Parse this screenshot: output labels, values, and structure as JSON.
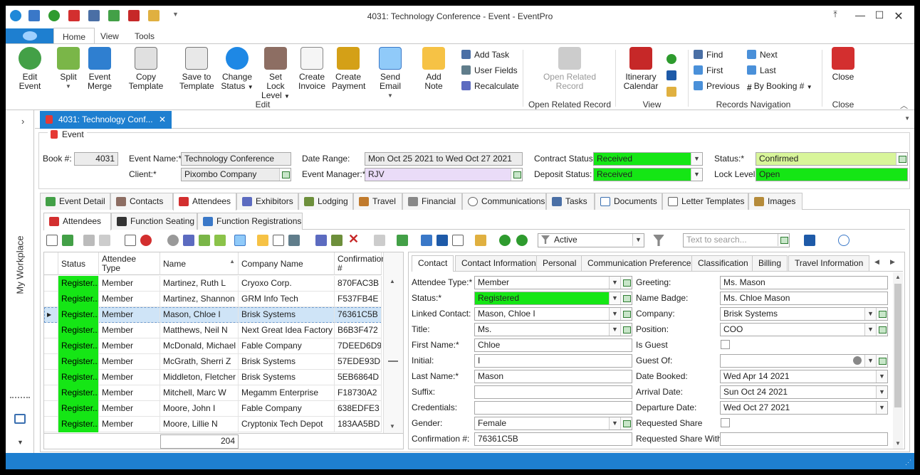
{
  "window": {
    "title": "4031: Technology Conference - Event - EventPro"
  },
  "ribbon_tabs": [
    "Home",
    "View",
    "Tools"
  ],
  "ribbon": {
    "edit_group": {
      "label": "Edit",
      "buttons": [
        "Edit Event",
        "Split",
        "Event Merge",
        "Copy Template",
        "Save to Template",
        "Change Status",
        "Set Lock Level",
        "Create Invoice",
        "Create Payment",
        "Send Email",
        "Add Note"
      ],
      "split_l1": "Split",
      "event_merge_l1": "Event",
      "event_merge_l2": "Merge",
      "save_l1": "Save to",
      "save_l2": "Template",
      "change_l1": "Change",
      "change_l2": "Status",
      "lock_l1": "Set Lock",
      "lock_l2": "Level",
      "inv_l1": "Create",
      "inv_l2": "Invoice",
      "pay_l1": "Create",
      "pay_l2": "Payment",
      "small": [
        "Add Task",
        "User Fields",
        "Recalculate"
      ]
    },
    "open_related": {
      "label": "Open Related Record",
      "l1": "Open Related",
      "l2": "Record"
    },
    "view_group": {
      "label": "View",
      "l1": "Itinerary",
      "l2": "Calendar"
    },
    "nav_group": {
      "label": "Records Navigation",
      "items": [
        "Find",
        "First",
        "Previous",
        "Next",
        "Last",
        "By Booking #"
      ]
    },
    "close_group": {
      "label": "Close",
      "button": "Close"
    }
  },
  "sidebar": {
    "label": "My Workplace"
  },
  "doc_tab": {
    "label": "4031: Technology Conf..."
  },
  "event": {
    "legend": "Event",
    "book_label": "Book #:",
    "book_value": "4031",
    "event_name_label": "Event Name:*",
    "event_name": "Technology Conference",
    "client_label": "Client:*",
    "client": "Pixombo Company",
    "date_range_label": "Date Range:",
    "date_range": "Mon Oct 25 2021 to Wed Oct 27 2021",
    "event_manager_label": "Event Manager:*",
    "event_manager": "RJV",
    "contract_status_label": "Contract Status:",
    "contract_status": "Received",
    "deposit_status_label": "Deposit Status:",
    "deposit_status": "Received",
    "status_label": "Status:*",
    "status": "Confirmed",
    "lock_level_label": "Lock Level:",
    "lock_level": "Open"
  },
  "main_tabs": [
    "Event Detail",
    "Contacts",
    "Attendees",
    "Exhibitors",
    "Lodging",
    "Travel",
    "Financial",
    "Communications",
    "Tasks",
    "Documents",
    "Letter Templates",
    "Images"
  ],
  "sub_tabs": [
    "Attendees",
    "Function Seating",
    "Function Registrations"
  ],
  "toolbar": {
    "filter_value": "Active",
    "search_placeholder": "Text to search..."
  },
  "grid": {
    "headers": [
      "Status",
      "Attendee Type",
      "Name",
      "Company Name",
      "Confirmation #"
    ],
    "rows": [
      [
        "Register...",
        "Member",
        "Martinez, Ruth L",
        "Cryoxo Corp.",
        "870FAC3B"
      ],
      [
        "Register...",
        "Member",
        "Martinez, Shannon M",
        "GRM Info Tech",
        "F537FB4E"
      ],
      [
        "Register...",
        "Member",
        "Mason, Chloe I",
        "Brisk Systems",
        "76361C5B"
      ],
      [
        "Register...",
        "Member",
        "Matthews, Neil N",
        "Next Great Idea Factory",
        "B6B3F472"
      ],
      [
        "Register...",
        "Member",
        "McDonald, Michael L",
        "Fable Company",
        "7DEED6D9"
      ],
      [
        "Register...",
        "Member",
        "McGrath, Sherri Z",
        "Brisk Systems",
        "57EDE93D"
      ],
      [
        "Register...",
        "Member",
        "Middleton, Fletcher F",
        "Brisk Systems",
        "5EB6864D"
      ],
      [
        "Register...",
        "Member",
        "Mitchell, Marc W",
        "Megamm Enterprise",
        "F18730A2"
      ],
      [
        "Register...",
        "Member",
        "Moore, John I",
        "Fable Company",
        "638EDFE3"
      ],
      [
        "Register...",
        "Member",
        "Moore, Lillie N",
        "Cryptonix Tech Depot",
        "183AA5BD"
      ]
    ],
    "selected_index": 2,
    "count": "204"
  },
  "detail_tabs": [
    "Contact",
    "Contact Information",
    "Personal",
    "Communication Preferences",
    "Classification",
    "Billing",
    "Travel Information"
  ],
  "detail": {
    "attendee_type_label": "Attendee Type:*",
    "attendee_type": "Member",
    "status_label": "Status:*",
    "status": "Registered",
    "linked_contact_label": "Linked Contact:",
    "linked_contact": "Mason, Chloe I",
    "title_label": "Title:",
    "title": "Ms.",
    "first_name_label": "First Name:*",
    "first_name": "Chloe",
    "initial_label": "Initial:",
    "initial": "I",
    "last_name_label": "Last Name:*",
    "last_name": "Mason",
    "suffix_label": "Suffix:",
    "suffix": "",
    "credentials_label": "Credentials:",
    "credentials": "",
    "gender_label": "Gender:",
    "gender": "Female",
    "confirmation_label": "Confirmation #:",
    "confirmation": "76361C5B",
    "greeting_label": "Greeting:",
    "greeting": "Ms. Mason",
    "name_badge_label": "Name Badge:",
    "name_badge": "Ms. Chloe Mason",
    "company_label": "Company:",
    "company": "Brisk Systems",
    "position_label": "Position:",
    "position": "COO",
    "is_guest_label": "Is Guest",
    "guest_of_label": "Guest Of:",
    "guest_of": "",
    "date_booked_label": "Date Booked:",
    "date_booked": "Wed Apr 14 2021",
    "arrival_label": "Arrival Date:",
    "arrival": "Sun Oct 24 2021",
    "departure_label": "Departure Date:",
    "departure": "Wed Oct 27 2021",
    "requested_share_label": "Requested Share",
    "requested_share_with_label": "Requested Share With:",
    "requested_share_with": ""
  },
  "colors": {
    "accent": "#1E7FD0",
    "green": "#15E615",
    "light_green": "#D8F59A",
    "lilac": "#EADCF8"
  }
}
